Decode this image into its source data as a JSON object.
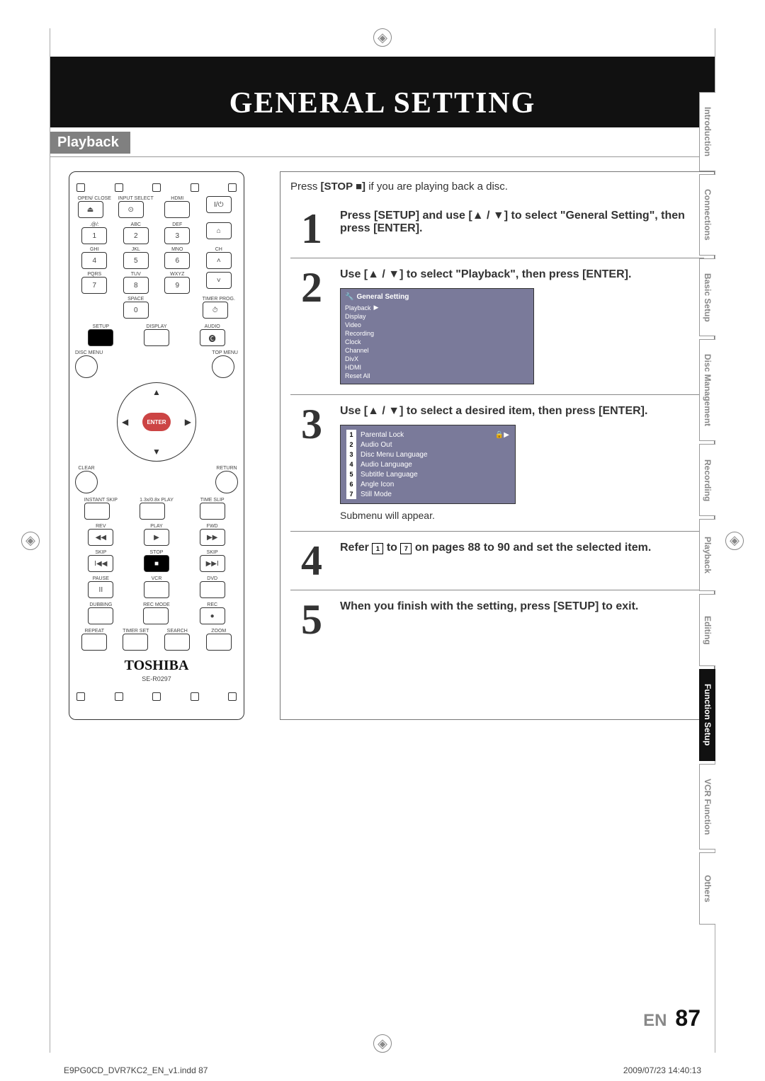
{
  "header": {
    "title": "GENERAL SETTING"
  },
  "subhead": "Playback",
  "intro": {
    "pre": "Press ",
    "stop": "[STOP ■]",
    "post": " if you are playing back a disc."
  },
  "steps": {
    "s1": {
      "num": "1",
      "text": "Press [SETUP] and use [▲ / ▼] to select \"General Setting\", then press [ENTER]."
    },
    "s2": {
      "num": "2",
      "text": "Use [▲ / ▼] to select \"Playback\", then press [ENTER].",
      "menu_title": "General Setting",
      "menu_items": [
        "Playback",
        "Display",
        "Video",
        "Recording",
        "Clock",
        "Channel",
        "DivX",
        "HDMI",
        "Reset All"
      ]
    },
    "s3": {
      "num": "3",
      "text": "Use [▲ / ▼] to select a desired item, then press [ENTER].",
      "submenu": [
        "Parental Lock",
        "Audio Out",
        "Disc Menu Language",
        "Audio Language",
        "Subtitle Language",
        "Angle Icon",
        "Still Mode"
      ],
      "caption": "Submenu will appear."
    },
    "s4": {
      "num": "4",
      "pre": "Refer ",
      "b1": "1",
      "mid": " to ",
      "b2": "7",
      "post": " on pages 88 to 90 and set the selected item."
    },
    "s5": {
      "num": "5",
      "text": "When you finish with the setting, press [SETUP] to exit."
    }
  },
  "remote": {
    "row1": [
      "OPEN/\nCLOSE",
      "INPUT\nSELECT",
      "HDMI",
      ""
    ],
    "numlabels": [
      ".@/:",
      "ABC",
      "DEF",
      "GHI",
      "JKL",
      "MNO",
      "PQRS",
      "TUV",
      "WXYZ"
    ],
    "nums": [
      "1",
      "2",
      "3",
      "4",
      "5",
      "6",
      "7",
      "8",
      "9",
      "0"
    ],
    "space": "SPACE",
    "ch": "CH",
    "timer": "TIMER\nPROG.",
    "setup": "SETUP",
    "display": "DISPLAY",
    "audio": "AUDIO",
    "discmenu": "DISC MENU",
    "topmenu": "TOP MENU",
    "enter": "ENTER",
    "clear": "CLEAR",
    "return": "RETURN",
    "instant": "INSTANT\nSKIP",
    "play13": "1.3x/0.8x\nPLAY",
    "timeslip": "TIME SLIP",
    "rev": "REV",
    "play": "PLAY",
    "fwd": "FWD",
    "skipL": "SKIP",
    "stop": "STOP",
    "skipR": "SKIP",
    "pause": "PAUSE",
    "vcr": "VCR",
    "dvd": "DVD",
    "dubbing": "DUBBING",
    "recmode": "REC MODE",
    "rec": "REC",
    "repeat": "REPEAT",
    "timerset": "TIMER SET",
    "search": "SEARCH",
    "zoom": "ZOOM",
    "brand": "TOSHIBA",
    "model": "SE-R0297"
  },
  "tabs": [
    "Introduction",
    "Connections",
    "Basic Setup",
    "Disc\nManagement",
    "Recording",
    "Playback",
    "Editing",
    "Function Setup",
    "VCR Function",
    "Others"
  ],
  "active_tab": "Function Setup",
  "footer": {
    "lang": "EN",
    "page": "87",
    "file": "E9PG0CD_DVR7KC2_EN_v1.indd   87",
    "ts": "2009/07/23   14:40:13"
  }
}
